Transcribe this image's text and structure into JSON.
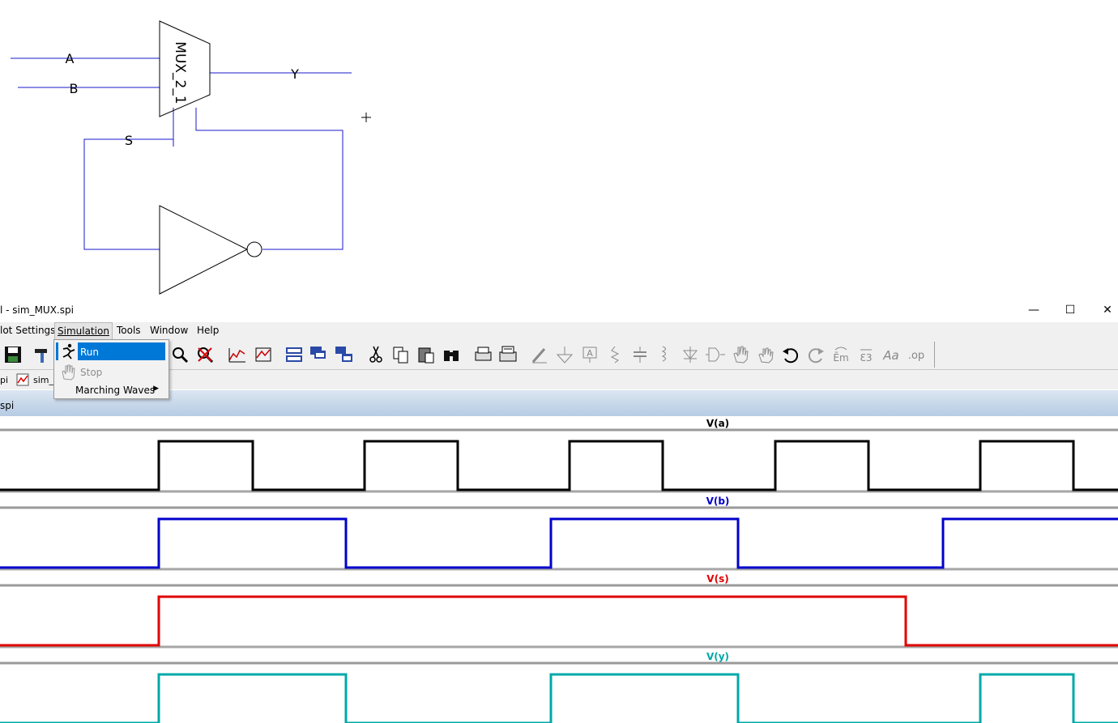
{
  "schematic": {
    "mux_label": "MUX_2_1",
    "net_a": "A",
    "net_b": "B",
    "net_s": "S",
    "net_y": "Y",
    "wire_color": "#1a1acd"
  },
  "window": {
    "title": "l - sim_MUX.spi",
    "minimize": "—",
    "maximize": "☐",
    "close": "✕"
  },
  "menubar": {
    "items": [
      "lot Settings",
      "Simulation",
      "Tools",
      "Window",
      "Help"
    ],
    "open_menu": "Simulation"
  },
  "simulation_menu": {
    "items": [
      {
        "label": "Run",
        "icon": "run-icon",
        "highlighted": true
      },
      {
        "label": "Stop",
        "icon": "stop-hand-icon",
        "disabled": true
      },
      {
        "label": "Marching Waves",
        "submenu": true
      }
    ]
  },
  "toolbar": {
    "icons": [
      "save-icon",
      "hammer-icon",
      "zoom-in-icon",
      "zoom-cancel-icon",
      "autorange-icon",
      "marker-icon",
      "tile-horizontal-icon",
      "cascade-icon",
      "tile-windows-icon",
      "cut-icon",
      "copy-icon",
      "paste-icon",
      "find-icon",
      "print-icon",
      "print-preview-icon",
      "draw-wire-icon",
      "ground-icon",
      "label-net-icon",
      "resistor-icon",
      "capacitor-icon",
      "inductor-icon",
      "diode-icon",
      "component-icon",
      "move-hand-icon",
      "drag-hand-icon",
      "undo-icon",
      "redo-icon",
      "rotate-icon",
      "mirror-icon",
      "text-icon",
      "spice-directive-icon"
    ]
  },
  "tabs": {
    "items": [
      "pi",
      "sim_M"
    ]
  },
  "plot": {
    "title": "spi",
    "traces": [
      {
        "name": "V(a)",
        "color": "#000000"
      },
      {
        "name": "V(b)",
        "color": "#0000cc"
      },
      {
        "name": "V(s)",
        "color": "#e00000"
      },
      {
        "name": "V(y)",
        "color": "#00a8a8"
      }
    ]
  },
  "chart_data": {
    "type": "line",
    "title": "",
    "xlabel": "",
    "ylabel": "",
    "x_range": [
      0,
      1380
    ],
    "grid": false,
    "series": [
      {
        "name": "V(a)",
        "values": [
          [
            0,
            0
          ],
          [
            196,
            0
          ],
          [
            196,
            1
          ],
          [
            312,
            1
          ],
          [
            312,
            0
          ],
          [
            450,
            0
          ],
          [
            450,
            1
          ],
          [
            565,
            1
          ],
          [
            565,
            0
          ],
          [
            703,
            0
          ],
          [
            703,
            1
          ],
          [
            818,
            1
          ],
          [
            818,
            0
          ],
          [
            957,
            0
          ],
          [
            957,
            1
          ],
          [
            1072,
            1
          ],
          [
            1072,
            0
          ],
          [
            1210,
            0
          ],
          [
            1210,
            1
          ],
          [
            1325,
            1
          ],
          [
            1325,
            0
          ],
          [
            1380,
            0
          ]
        ]
      },
      {
        "name": "V(b)",
        "values": [
          [
            0,
            0
          ],
          [
            196,
            0
          ],
          [
            196,
            1
          ],
          [
            427,
            1
          ],
          [
            427,
            0
          ],
          [
            680,
            0
          ],
          [
            680,
            1
          ],
          [
            911,
            1
          ],
          [
            911,
            0
          ],
          [
            1164,
            0
          ],
          [
            1164,
            1
          ],
          [
            1380,
            1
          ]
        ]
      },
      {
        "name": "V(s)",
        "values": [
          [
            0,
            0
          ],
          [
            196,
            0
          ],
          [
            196,
            1
          ],
          [
            1118,
            1
          ],
          [
            1118,
            0
          ],
          [
            1380,
            0
          ]
        ]
      },
      {
        "name": "V(y)",
        "values": [
          [
            0,
            0
          ],
          [
            196,
            0
          ],
          [
            196,
            1
          ],
          [
            427,
            1
          ],
          [
            427,
            0
          ],
          [
            680,
            0
          ],
          [
            680,
            1
          ],
          [
            911,
            1
          ],
          [
            911,
            0
          ],
          [
            1118,
            0
          ],
          [
            1164,
            0
          ],
          [
            1164,
            0
          ],
          [
            1210,
            0
          ],
          [
            1210,
            1
          ],
          [
            1325,
            1
          ],
          [
            1325,
            0
          ],
          [
            1380,
            0
          ]
        ]
      }
    ]
  }
}
